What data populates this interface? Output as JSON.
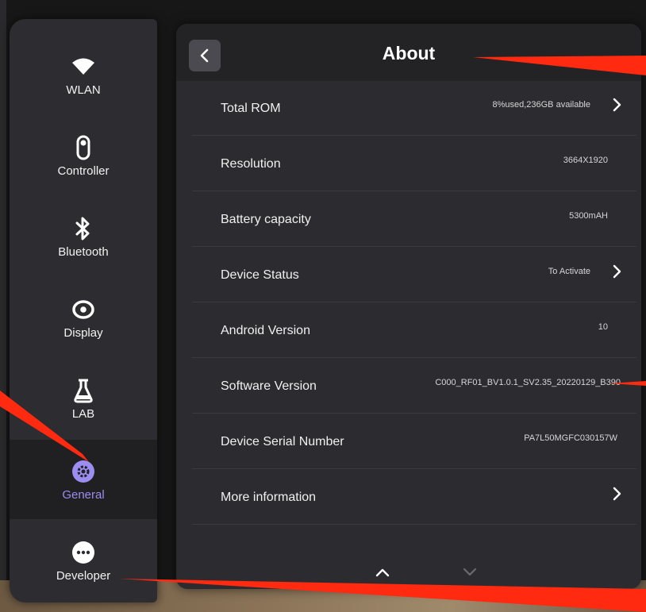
{
  "sidebar": {
    "items": [
      {
        "label": "WLAN",
        "icon": "wifi-icon",
        "active": false
      },
      {
        "label": "Controller",
        "icon": "controller-icon",
        "active": false
      },
      {
        "label": "Bluetooth",
        "icon": "bluetooth-icon",
        "active": false
      },
      {
        "label": "Display",
        "icon": "eye-icon",
        "active": false
      },
      {
        "label": "LAB",
        "icon": "flask-icon",
        "active": false
      },
      {
        "label": "General",
        "icon": "gear-icon",
        "active": true
      },
      {
        "label": "Developer",
        "icon": "ellipsis-icon",
        "active": false
      }
    ]
  },
  "header": {
    "title": "About",
    "back_icon": "chevron-left-icon"
  },
  "rows": [
    {
      "label": "Total ROM",
      "value": "8%used,236GB available",
      "chevron": true
    },
    {
      "label": "Resolution",
      "value": "3664X1920",
      "chevron": false
    },
    {
      "label": "Battery capacity",
      "value": "5300mAH",
      "chevron": false
    },
    {
      "label": "Device Status",
      "value": "To Activate",
      "chevron": true
    },
    {
      "label": "Android Version",
      "value": "10",
      "chevron": false
    },
    {
      "label": "Software Version",
      "value": "C000_RF01_BV1.0.1_SV2.35_20220129_B390",
      "chevron": false
    },
    {
      "label": "Device Serial Number",
      "value": "PA7L50MGFC030157W",
      "chevron": false
    },
    {
      "label": "More information",
      "value": "",
      "chevron": true
    }
  ],
  "pager": {
    "up_icon": "chevron-up-icon",
    "down_icon": "chevron-down-icon"
  },
  "colors": {
    "accent": "#9c8df0",
    "annotation": "#ff2a10",
    "panel": "#2c2c30",
    "sidebar": "#2d2d31"
  }
}
